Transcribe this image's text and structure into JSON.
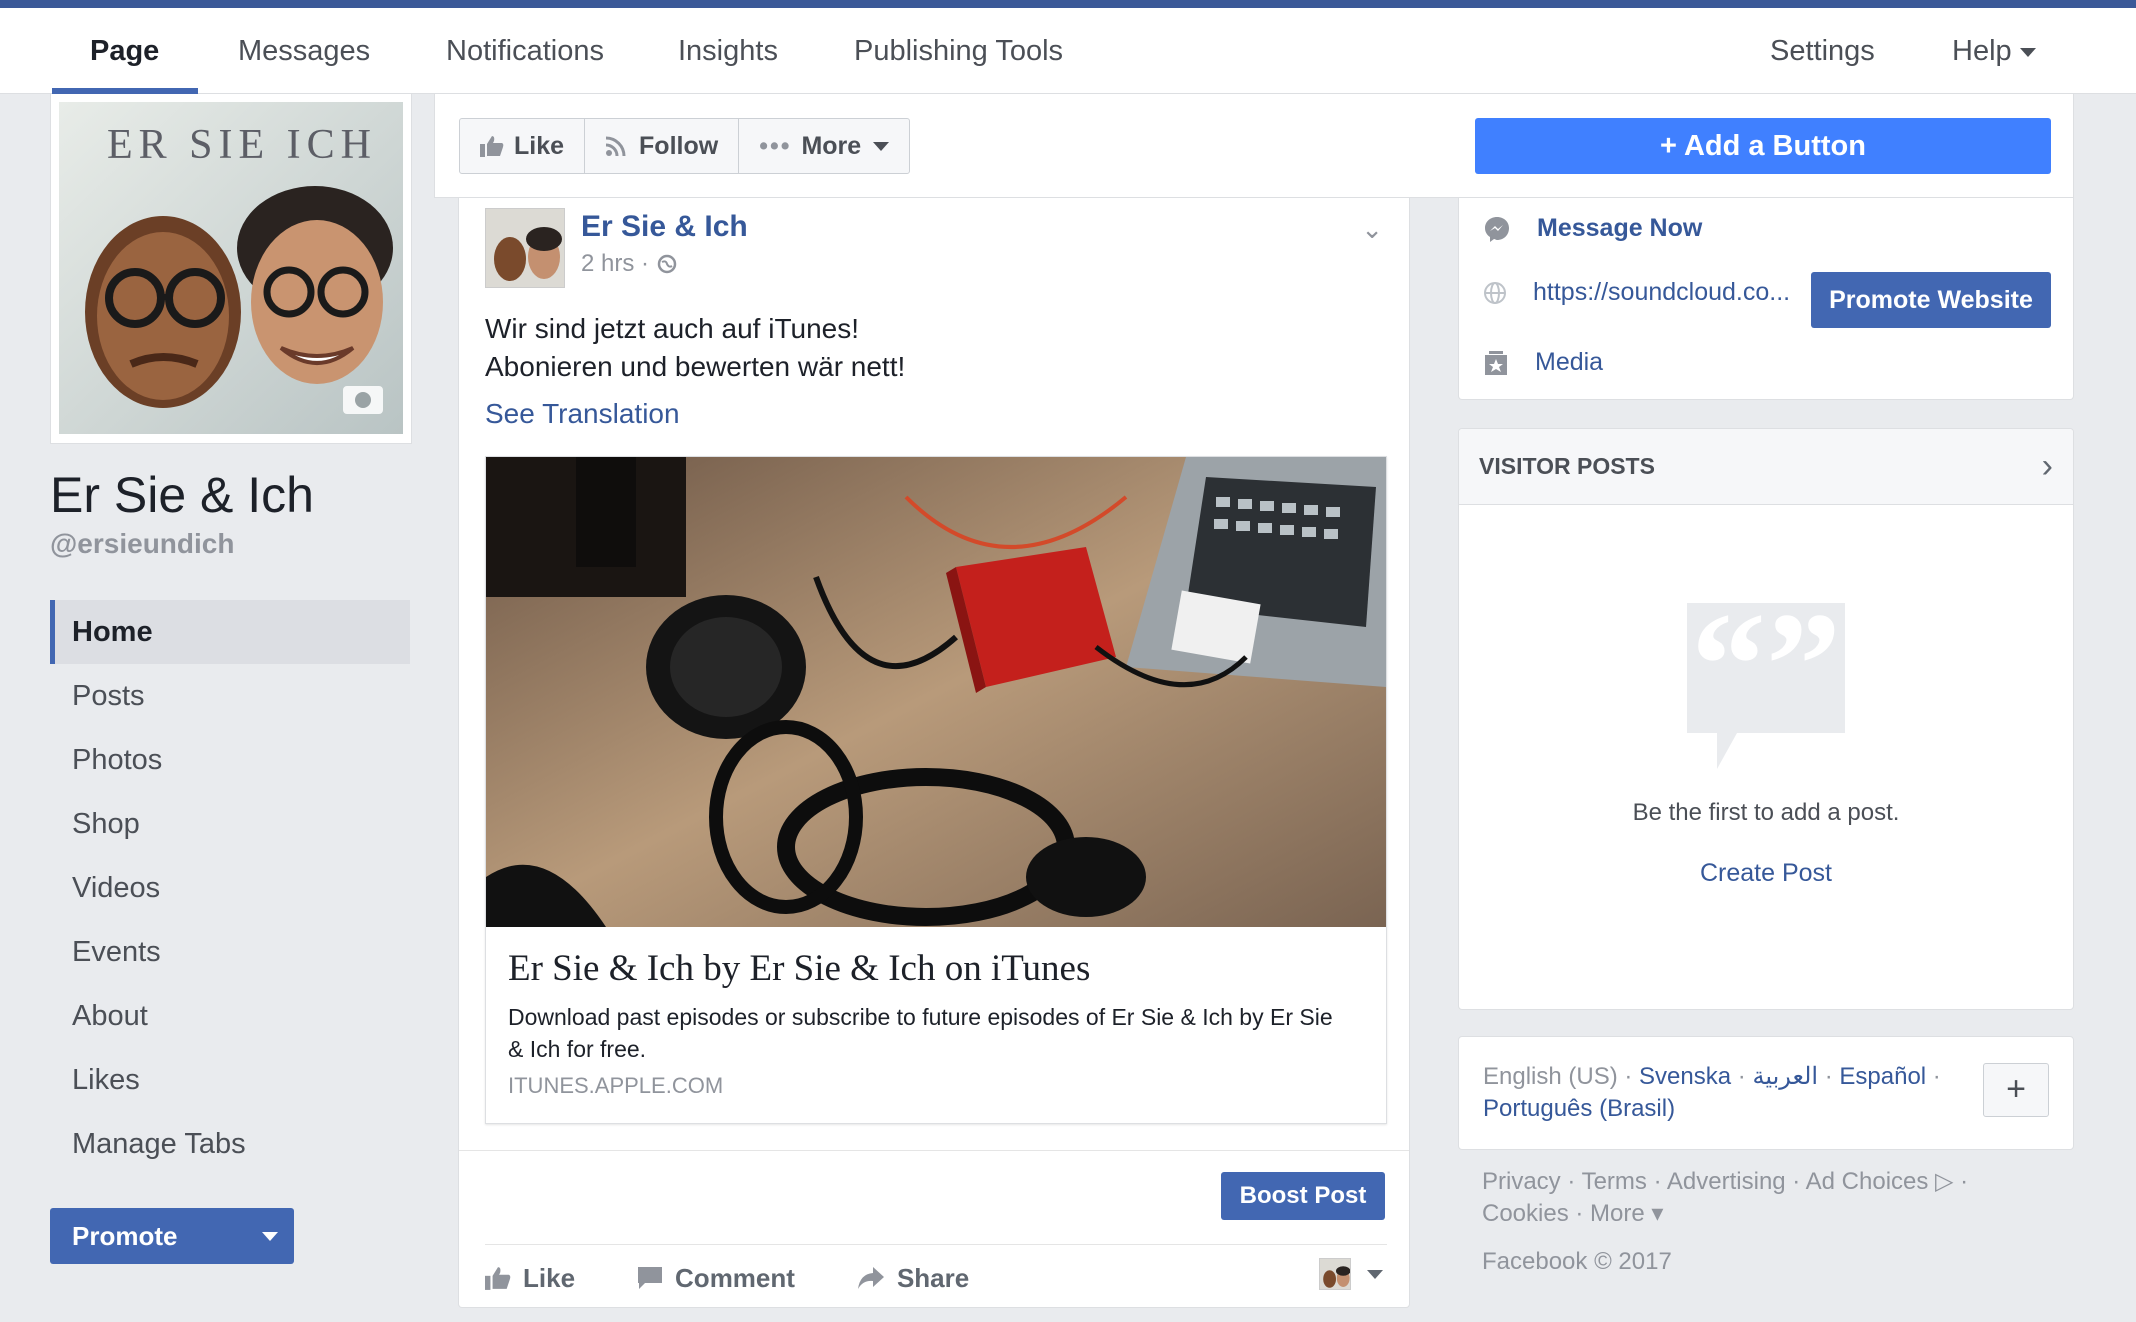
{
  "nav": {
    "page": "Page",
    "messages": "Messages",
    "notifications": "Notifications",
    "insights": "Insights",
    "publishing_tools": "Publishing Tools",
    "settings": "Settings",
    "help": "Help"
  },
  "profile": {
    "cover_lettering": "ER SIE ICH",
    "name": "Er Sie & Ich",
    "handle": "@ersieundich"
  },
  "left_nav": [
    "Home",
    "Posts",
    "Photos",
    "Shop",
    "Videos",
    "Events",
    "About",
    "Likes",
    "Manage Tabs"
  ],
  "promote": "Promote",
  "action_bar": {
    "like": "Like",
    "follow": "Follow",
    "more": "More",
    "add_button": "+ Add a Button"
  },
  "post": {
    "author": "Er Sie & Ich",
    "time": "2 hrs ·",
    "text_line1": "Wir sind jetzt auch auf iTunes!",
    "text_line2": "Abonieren und bewerten wär nett!",
    "see_translation": "See Translation",
    "link_title": "Er Sie & Ich by Er Sie & Ich on iTunes",
    "link_desc": "Download past episodes or subscribe to future episodes of Er Sie & Ich by Er Sie & Ich for free.",
    "link_domain": "ITUNES.APPLE.COM",
    "boost": "Boost Post",
    "like": "Like",
    "comment": "Comment",
    "share": "Share"
  },
  "about": {
    "message_now": "Message Now",
    "website": "https://soundcloud.co...",
    "promote_website": "Promote Website",
    "media": "Media"
  },
  "visitor_posts": {
    "title": "VISITOR POSTS",
    "empty": "Be the first to add a post.",
    "create": "Create Post"
  },
  "languages": {
    "current": "English (US) ·",
    "svenska": "Svenska",
    "sep1": "·",
    "arabic": "العربية",
    "sep2": "·",
    "espanol": "Español",
    "sep3": "·",
    "portugues": "Português (Brasil)",
    "plus": "+"
  },
  "footer": {
    "links": "Privacy · Terms · Advertising · Ad Choices ▷ · Cookies · More ▾",
    "copyright": "Facebook © 2017"
  },
  "colors": {
    "brand": "#3b5998",
    "accent": "#4267b2",
    "add_button": "#4080ff",
    "link": "#365899"
  }
}
